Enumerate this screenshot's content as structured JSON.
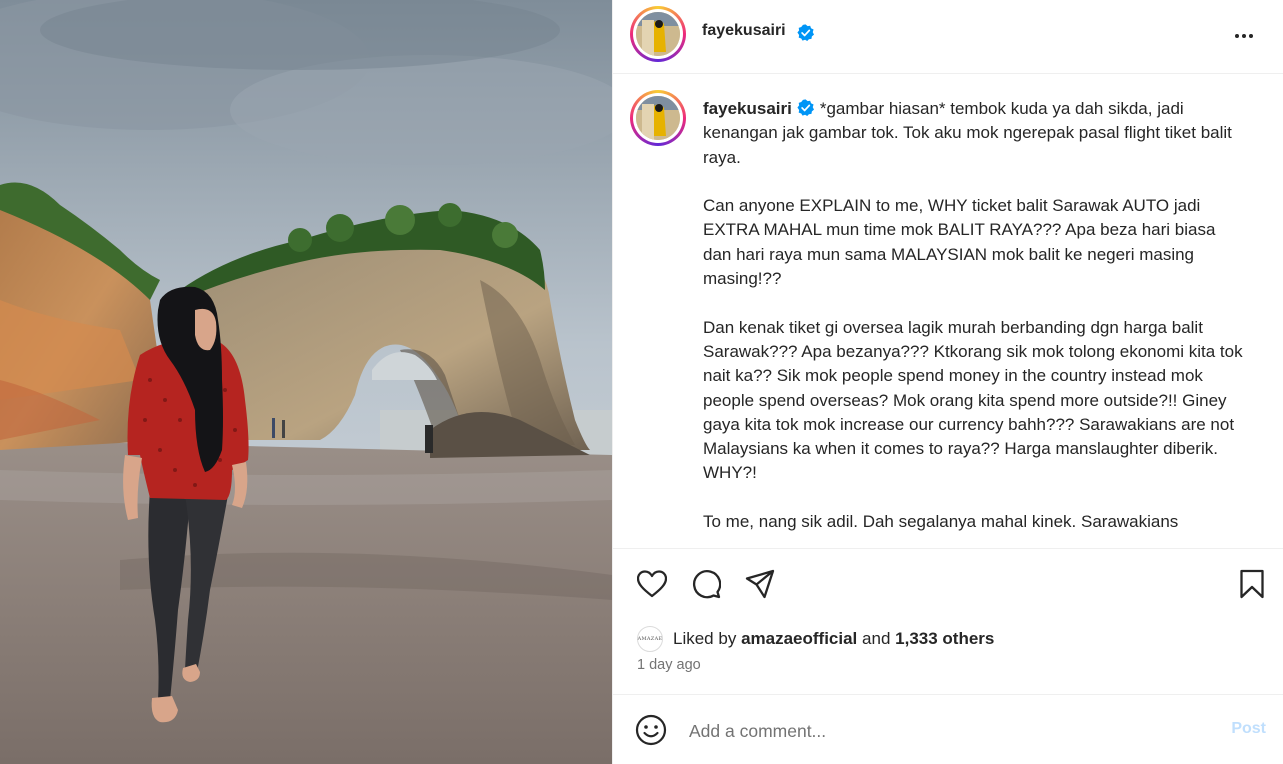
{
  "post": {
    "username": "fayekusairi",
    "verified": true,
    "caption_user": "fayekusairi",
    "caption": "*gambar hiasan* tembok kuda ya dah sikda, jadi kenangan jak gambar tok. Tok aku mok ngerepak pasal flight tiket balit raya.\n\nCan anyone EXPLAIN to me, WHY ticket balit Sarawak AUTO jadi EXTRA MAHAL mun time mok BALIT RAYA??? Apa beza hari biasa dan hari raya mun sama MALAYSIAN mok balit ke negeri masing masing!??\n\nDan kenak tiket gi oversea lagik murah berbanding dgn harga balit Sarawak??? Apa bezanya??? Ktkorang sik mok tolong ekonomi kita tok nait ka?? Sik mok people spend money in the country instead mok people spend overseas? Mok orang kita spend more outside?!! Giney gaya kita tok mok increase our currency bahh??? Sarawakians are not Malaysians ka when it comes to raya?? Harga manslaughter diberik. WHY?!\n\nTo me, nang sik adil. Dah segalanya mahal kinek. Sarawakians"
  },
  "likes": {
    "prefix": "Liked by",
    "liker": "amazaeofficial",
    "conjunction": "and",
    "others": "1,333 others",
    "liker_avatar_text": "AMAZAE"
  },
  "timestamp": "1 day ago",
  "comment": {
    "placeholder": "Add a comment...",
    "post_label": "Post"
  },
  "icons": {
    "more": "more-options-icon",
    "like": "heart-icon",
    "comment": "comment-icon",
    "share": "share-icon",
    "save": "bookmark-icon",
    "emoji": "emoji-icon",
    "verified": "verified-badge-icon"
  },
  "colors": {
    "verified": "#0095f6",
    "post_disabled": "#c0dffd",
    "muted_text": "#737373",
    "divider": "#efefef"
  }
}
